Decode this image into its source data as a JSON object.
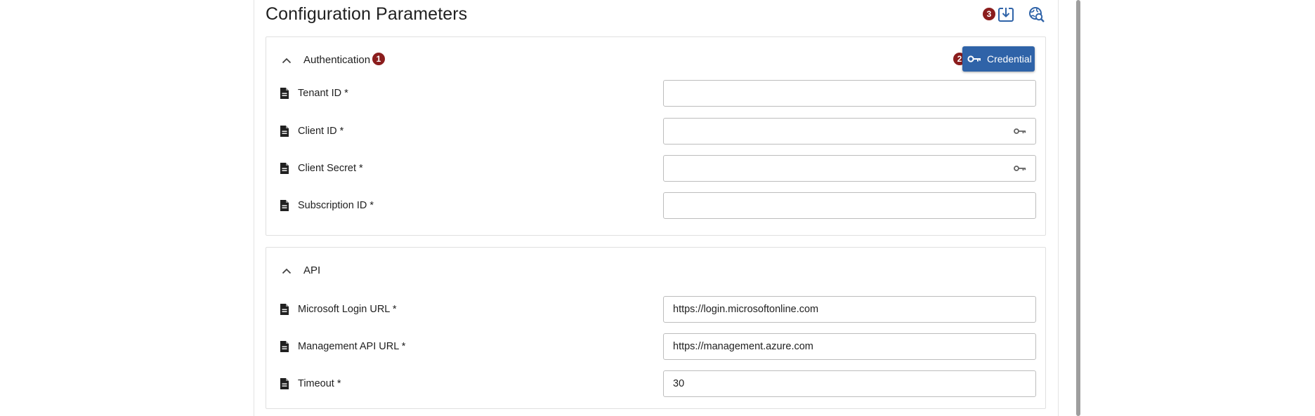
{
  "header": {
    "title": "Configuration Parameters",
    "import_badge": "3",
    "import_icon": "import-download-icon",
    "search_icon": "globe-search-icon"
  },
  "sections": {
    "auth": {
      "title": "Authentication",
      "badge": "1",
      "credential_badge": "2",
      "credential_label": "Credential",
      "fields": [
        {
          "label": "Tenant ID *",
          "value": "",
          "adornment": ""
        },
        {
          "label": "Client ID *",
          "value": "",
          "adornment": "key-icon"
        },
        {
          "label": "Client Secret *",
          "value": "",
          "adornment": "key-icon"
        },
        {
          "label": "Subscription ID *",
          "value": "",
          "adornment": ""
        }
      ]
    },
    "api": {
      "title": "API",
      "fields": [
        {
          "label": "Microsoft Login URL *",
          "value": "https://login.microsoftonline.com"
        },
        {
          "label": "Management API URL *",
          "value": "https://management.azure.com"
        },
        {
          "label": "Timeout *",
          "value": "30"
        }
      ]
    }
  },
  "colors": {
    "primary": "#2f63a8",
    "badge": "#8b1d1d",
    "icon_blue": "#2f63a8",
    "border": "#bdbdbd"
  }
}
